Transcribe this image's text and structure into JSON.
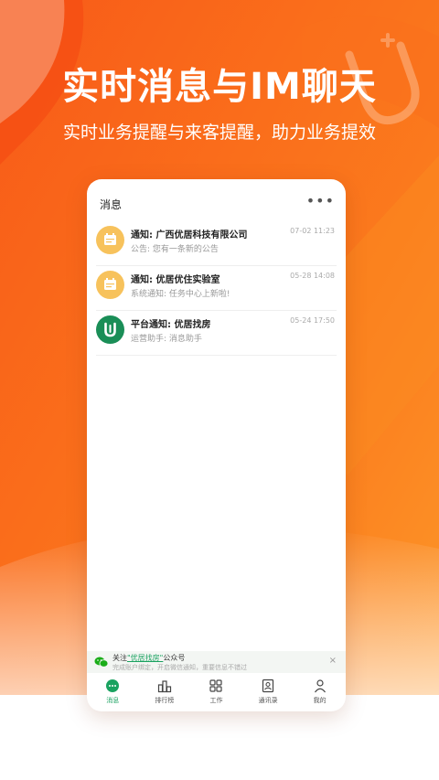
{
  "hero": {
    "title": "实时消息与IM聊天",
    "subtitle": "实时业务提醒与来客提醒，助力业务提效"
  },
  "header": {
    "title": "消息",
    "more_icon": "more-horizontal-icon",
    "more_glyph": "•••"
  },
  "messages": [
    {
      "title": "通知: 广西优居科技有限公司",
      "preview": "公告: 您有一条新的公告",
      "time": "07-02 11:23",
      "icon": "calendar-icon"
    },
    {
      "title": "通知: 优居优住实验室",
      "preview": "系统通知: 任务中心上新啦!",
      "time": "05-28 14:08",
      "icon": "calendar-icon"
    },
    {
      "title": "平台通知: 优居找房",
      "preview": "运营助手: 消息助手",
      "time": "05-24 17:50",
      "icon": "brand-u-icon"
    }
  ],
  "banner": {
    "prefix": "关注",
    "link": "\"优居找房\"",
    "suffix": "公众号",
    "desc": "完成账户绑定，开启微信通知，重要信息不错过",
    "close": "×"
  },
  "tabs": [
    {
      "label": "消息",
      "icon": "chat-icon"
    },
    {
      "label": "排行榜",
      "icon": "ranking-icon"
    },
    {
      "label": "工作",
      "icon": "grid-icon"
    },
    {
      "label": "通讯录",
      "icon": "contacts-icon"
    },
    {
      "label": "我的",
      "icon": "user-icon"
    }
  ],
  "colors": {
    "brand_orange": "#f76a1c",
    "accent_green": "#1aa260",
    "avatar_yellow": "#f7c25c"
  }
}
